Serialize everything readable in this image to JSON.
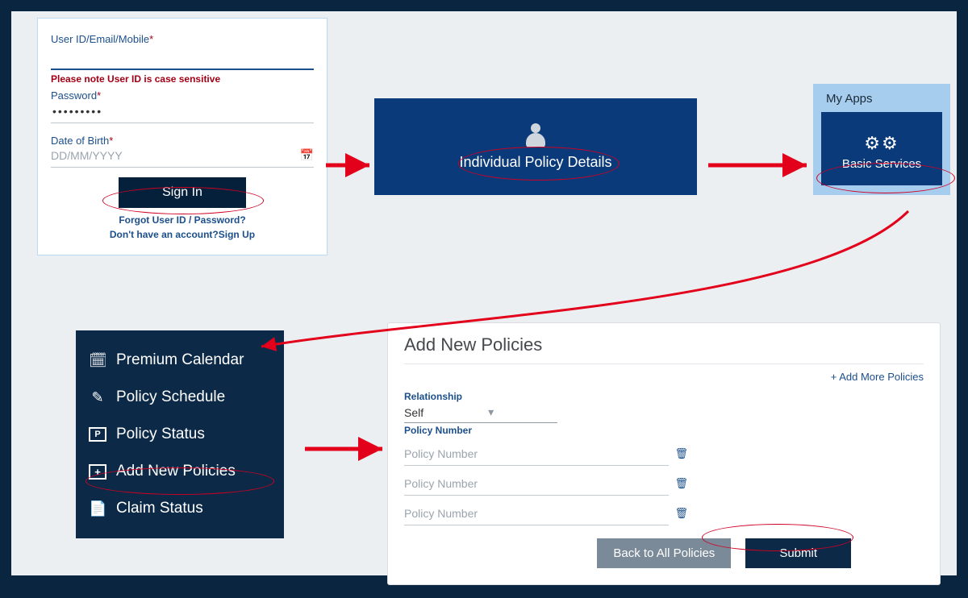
{
  "login": {
    "userid_label": "User ID/Email/Mobile",
    "note": "Please note User ID is case sensitive",
    "password_label": "Password",
    "password_value": "•••••••••",
    "dob_label": "Date of Birth",
    "dob_placeholder": "DD/MM/YYYY",
    "signin_label": "Sign In",
    "forgot_label": "Forgot User ID / Password?",
    "signup_prefix": "Don't have an account?",
    "signup_label": "Sign Up",
    "required_mark": "*"
  },
  "ipd": {
    "title": "Individual Policy Details"
  },
  "myapps": {
    "heading": "My Apps",
    "basic_services_label": "Basic Services"
  },
  "sidebar": {
    "items": [
      {
        "label": "Premium Calendar",
        "icon": "calendar"
      },
      {
        "label": "Policy Schedule",
        "icon": "edit"
      },
      {
        "label": "Policy Status",
        "icon": "doc-p"
      },
      {
        "label": "Add New Policies",
        "icon": "plus-box"
      },
      {
        "label": "Claim Status",
        "icon": "doc"
      }
    ]
  },
  "add": {
    "title": "Add New Policies",
    "add_more": "+ Add More Policies",
    "relationship_label": "Relationship",
    "relationship_value": "Self",
    "policy_number_label": "Policy Number",
    "placeholder": "Policy Number",
    "back_label": "Back to All Policies",
    "submit_label": "Submit"
  }
}
